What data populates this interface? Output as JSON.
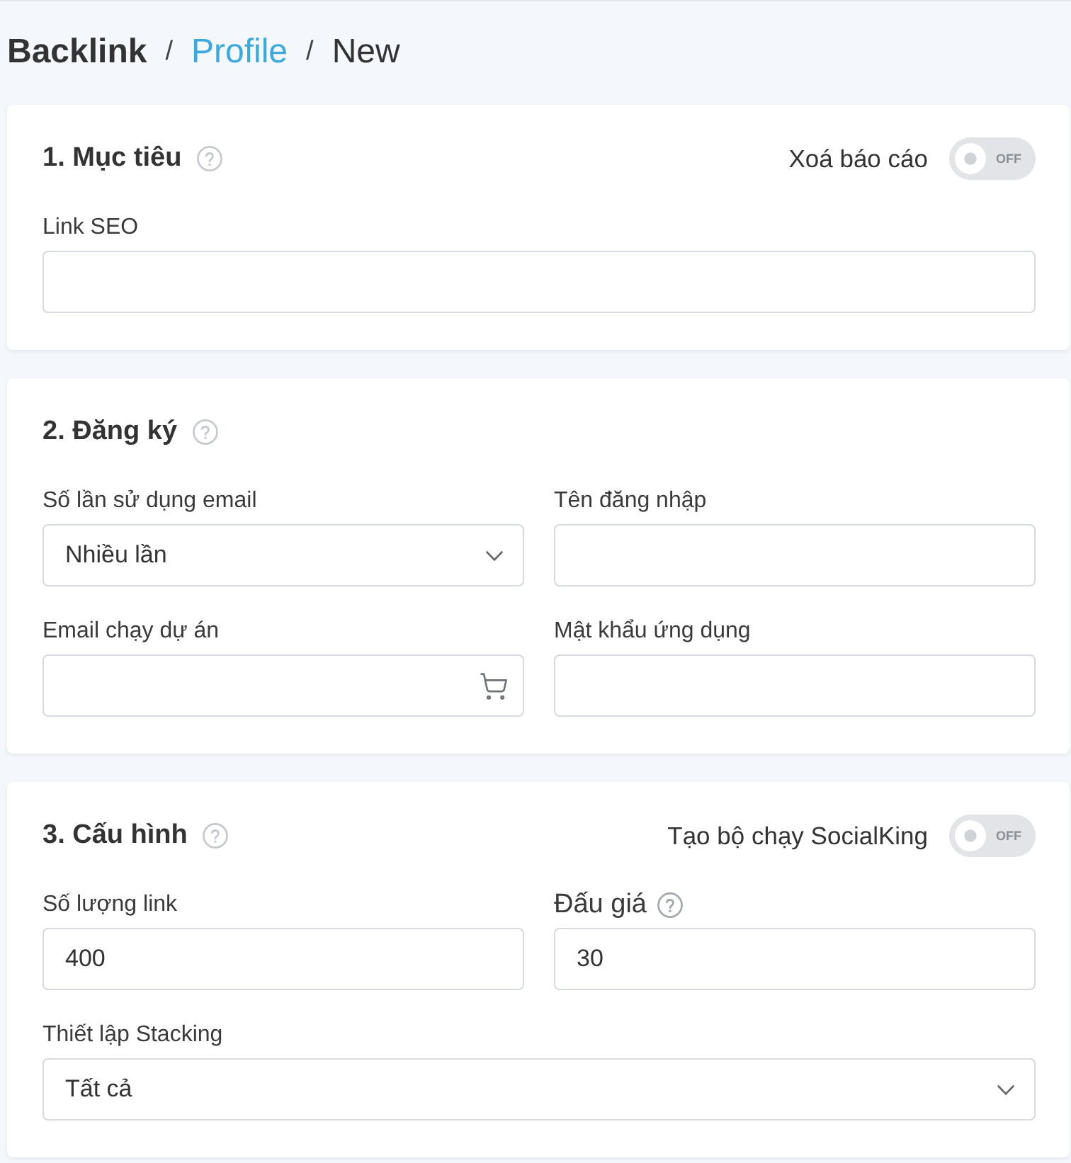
{
  "breadcrumb": {
    "separator": "/",
    "items": [
      {
        "label": "Backlink",
        "kind": "root"
      },
      {
        "label": "Profile",
        "kind": "link"
      },
      {
        "label": "New",
        "kind": "current"
      }
    ]
  },
  "sections": [
    {
      "title": "1. Mục tiêu",
      "help": true,
      "toggle": {
        "label": "Xoá báo cáo",
        "on": false,
        "text": "OFF"
      },
      "rows": [
        [
          {
            "label": "Link SEO",
            "kind": "text"
          }
        ]
      ]
    },
    {
      "title": "2. Đăng ký",
      "help": true,
      "rows": [
        [
          {
            "label": "Số lần sử dụng email",
            "kind": "select",
            "value": "Nhiều lần"
          },
          {
            "label": "Tên đăng nhập",
            "kind": "text"
          }
        ],
        [
          {
            "label": "Email chạy dự án",
            "kind": "cart"
          },
          {
            "label": "Mật khẩu ứng dụng",
            "kind": "text"
          }
        ]
      ]
    },
    {
      "title": "3. Cấu hình",
      "help": true,
      "toggle": {
        "label": "Tạo bộ chạy SocialKing",
        "on": false,
        "text": "OFF"
      },
      "rows": [
        [
          {
            "label": "Số lượng link",
            "kind": "text",
            "value": "400"
          },
          {
            "label": "Đấu giá",
            "kind": "text",
            "value": "30",
            "help": true
          }
        ],
        [
          {
            "label": "Thiết lập Stacking",
            "kind": "select",
            "value": "Tất cả"
          }
        ]
      ]
    }
  ]
}
